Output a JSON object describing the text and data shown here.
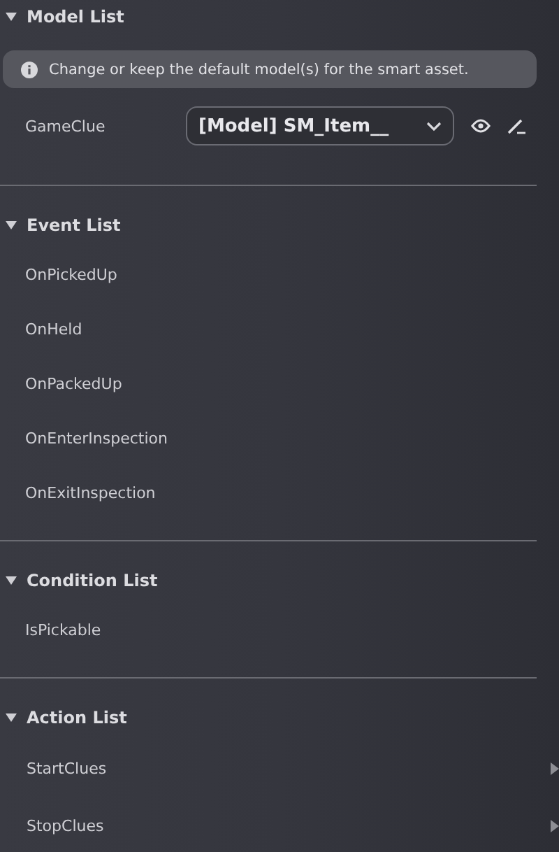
{
  "sections": [
    {
      "kind": "models",
      "title": "Model List",
      "expanded": true,
      "info": "Change or keep the default model(s) for the smart asset.",
      "models": [
        {
          "label": "GameClue",
          "value": "[Model] SM_Item__"
        }
      ]
    },
    {
      "kind": "events",
      "title": "Event List",
      "expanded": true,
      "items": [
        "OnPickedUp",
        "OnHeld",
        "OnPackedUp",
        "OnEnterInspection",
        "OnExitInspection"
      ]
    },
    {
      "kind": "events",
      "title": "Condition List",
      "expanded": true,
      "items": [
        "IsPickable"
      ]
    },
    {
      "kind": "actions",
      "title": "Action List",
      "expanded": true,
      "items": [
        "StartClues",
        "StopClues"
      ]
    }
  ]
}
